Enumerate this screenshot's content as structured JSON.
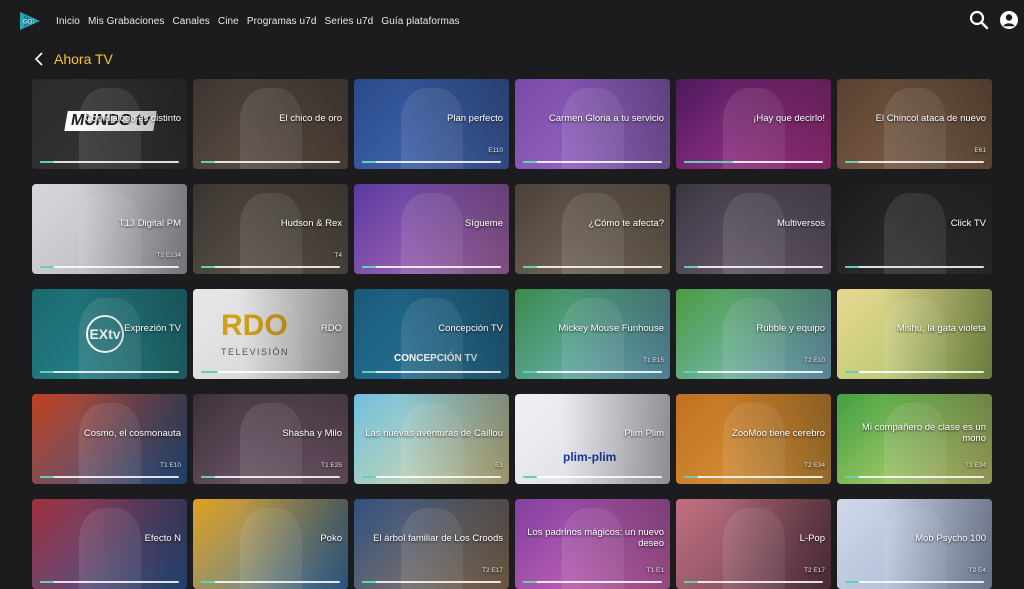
{
  "header": {
    "logo_text": "GO!",
    "nav": [
      "Inicio",
      "Mis Grabaciones",
      "Canales",
      "Cine",
      "Programas u7d",
      "Series u7d",
      "Guía plataformas"
    ]
  },
  "page": {
    "title": "Ahora TV"
  },
  "colors": {
    "accent": "#f3c623",
    "progress": "#5fd3b3",
    "background": "#1c1c1e"
  },
  "icons": [
    "search-icon",
    "user-icon",
    "chevron-left-icon"
  ],
  "cards": [
    {
      "title": "Con diálogo es distinto",
      "ep": "",
      "bg": "#2a2a2c",
      "bg2": "#3a3a3c",
      "logo": "MUNDO tv",
      "progress": 0.1
    },
    {
      "title": "El chico de oro",
      "ep": "",
      "bg": "#3d3530",
      "bg2": "#6a5a4e",
      "progress": 0.1
    },
    {
      "title": "Plan perfecto",
      "ep": "E110",
      "bg": "#2a4a8a",
      "bg2": "#4a70c0",
      "progress": 0.1
    },
    {
      "title": "Carmen Gloria a tu servicio",
      "ep": "",
      "bg": "#7a4aa8",
      "bg2": "#a070d0",
      "progress": 0.1
    },
    {
      "title": "¡Hay que decirlo!",
      "ep": "",
      "bg": "#4a1a5a",
      "bg2": "#c03a9a",
      "progress": 0.35
    },
    {
      "title": "El Chincol ataca de nuevo",
      "ep": "E61",
      "bg": "#5a4030",
      "bg2": "#8a6a50",
      "progress": 0.1
    },
    {
      "title": "T13 Digital PM",
      "ep": "T2 E134",
      "bg": "#d8d8dc",
      "bg2": "#b0b0b8",
      "progress": 0.1
    },
    {
      "title": "Hudson & Rex",
      "ep": "T4",
      "bg": "#3a3530",
      "bg2": "#6a6055",
      "progress": 0.1
    },
    {
      "title": "Sígueme",
      "ep": "",
      "bg": "#5a3aa0",
      "bg2": "#c078c0",
      "progress": 0.1
    },
    {
      "title": "¿Cómo te afecta?",
      "ep": "",
      "bg": "#4a4038",
      "bg2": "#8a7a68",
      "progress": 0.1
    },
    {
      "title": "Multiversos",
      "ep": "",
      "bg": "#3a3540",
      "bg2": "#7a6a80",
      "progress": 0.1
    },
    {
      "title": "Click TV",
      "ep": "",
      "bg": "#1a1a1c",
      "bg2": "#3a3a3e",
      "progress": 0.1
    },
    {
      "title": "Exprezión TV",
      "ep": "",
      "bg": "#1a6a70",
      "bg2": "#2a8a90",
      "logo": "EXtv",
      "progress": 0.1
    },
    {
      "title": "RDO",
      "ep": "",
      "bg": "#e8e8e8",
      "bg2": "#d0d0d0",
      "logo": "RDO",
      "logo_sub": "TELEVISIÓN",
      "progress": 0.12
    },
    {
      "title": "Concepción TV",
      "ep": "",
      "bg": "#1a5a7a",
      "bg2": "#2a7aa0",
      "logo": "CONCEPCIÓN TV",
      "progress": 0.1
    },
    {
      "title": "Mickey Mouse Funhouse",
      "ep": "T1 E15",
      "bg": "#3a8a4a",
      "bg2": "#7ac0e0",
      "progress": 0.1
    },
    {
      "title": "Rubble y equipo",
      "ep": "T2 E10",
      "bg": "#4a9a40",
      "bg2": "#8ac8e8",
      "progress": 0.1
    },
    {
      "title": "Mishu, la gata violeta",
      "ep": "",
      "bg": "#e8d890",
      "bg2": "#a0c060",
      "progress": 0.1
    },
    {
      "title": "Cosmo, el cosmonauta",
      "ep": "T1 E10",
      "bg": "#c04020",
      "bg2": "#2a60a0",
      "progress": 0.1
    },
    {
      "title": "Shasha y Milo",
      "ep": "T1 E25",
      "bg": "#3a3038",
      "bg2": "#8a6a80",
      "progress": 0.1
    },
    {
      "title": "Las nuevas aventuras de Caillou",
      "ep": "E1",
      "bg": "#70c0e0",
      "bg2": "#f0e0a0",
      "progress": 0.1
    },
    {
      "title": "Plim Plim",
      "ep": "",
      "bg": "#f0f0f4",
      "bg2": "#d8d8e0",
      "logo": "plim-plim",
      "progress": 0.1
    },
    {
      "title": "ZooMoo tiene cerebro",
      "ep": "T2 E34",
      "bg": "#c07020",
      "bg2": "#e0a040",
      "progress": 0.1
    },
    {
      "title": "Mi compañero de clase es un mono",
      "ep": "T3 E34",
      "bg": "#40a040",
      "bg2": "#e0e080",
      "progress": 0.1
    },
    {
      "title": "Efecto N",
      "ep": "",
      "bg": "#a03040",
      "bg2": "#3060a0",
      "progress": 0.1
    },
    {
      "title": "Poko",
      "ep": "",
      "bg": "#e0a020",
      "bg2": "#4080c0",
      "progress": 0.1
    },
    {
      "title": "El árbol familiar de Los Croods",
      "ep": "T2 E17",
      "bg": "#305080",
      "bg2": "#a08060",
      "progress": 0.1
    },
    {
      "title": "Los padrinos mágicos: un nuevo deseo",
      "ep": "T1 E1",
      "bg": "#8040a0",
      "bg2": "#e070c0",
      "progress": 0.1
    },
    {
      "title": "L-Pop",
      "ep": "T2 E17",
      "bg": "#c07080",
      "bg2": "#6a4050",
      "progress": 0.1
    },
    {
      "title": "Mob Psycho 100",
      "ep": "T2 E4",
      "bg": "#d0d8e8",
      "bg2": "#a0b0d0",
      "progress": 0.1
    }
  ]
}
